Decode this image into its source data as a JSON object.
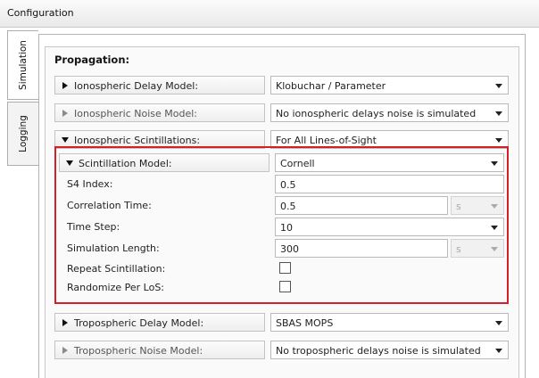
{
  "window": {
    "title": "Configuration"
  },
  "tabs": [
    {
      "label": "Simulation",
      "active": true
    },
    {
      "label": "Logging",
      "active": false
    }
  ],
  "section": {
    "title": "Propagation:"
  },
  "rows": {
    "iono_delay": {
      "label": "Ionospheric Delay Model:",
      "value": "Klobuchar / Parameter"
    },
    "iono_noise": {
      "label": "Ionospheric Noise Model:",
      "value": "No ionospheric delays noise is simulated"
    },
    "iono_scint": {
      "label": "Ionospheric Scintillations:",
      "value": "For All Lines-of-Sight"
    },
    "scint_model": {
      "label": "Scintillation Model:",
      "value": "Cornell"
    },
    "tropo_delay": {
      "label": "Tropospheric Delay Model:",
      "value": "SBAS MOPS"
    },
    "tropo_noise": {
      "label": "Tropospheric Noise Model:",
      "value": "No tropospheric delays noise is simulated"
    }
  },
  "scint": {
    "s4_label": "S4 Index:",
    "s4_value": "0.5",
    "corr_label": "Correlation Time:",
    "corr_value": "0.5",
    "corr_unit": "s",
    "step_label": "Time Step:",
    "step_value": "10",
    "length_label": "Simulation Length:",
    "length_value": "300",
    "length_unit": "s",
    "repeat_label": "Repeat Scintillation:",
    "repeat_checked": false,
    "randomize_label": "Randomize Per LoS:",
    "randomize_checked": false
  },
  "icons": [
    "expand-triangle-icon",
    "collapse-triangle-icon",
    "dropdown-arrow-icon"
  ],
  "colors": {
    "highlight": "#d41f29"
  }
}
